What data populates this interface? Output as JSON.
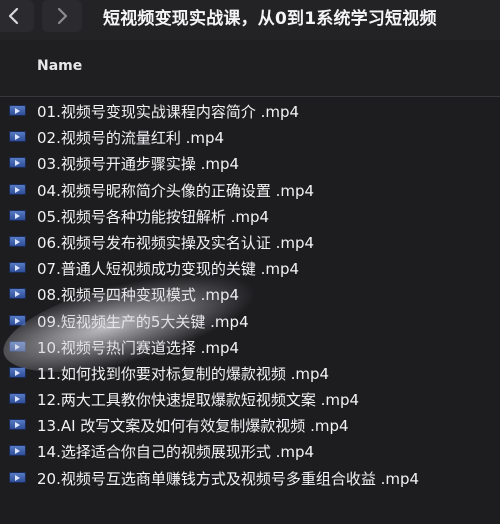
{
  "window": {
    "title": "短视频变现实战课，从0到1系统学习短视频"
  },
  "toolbar": {
    "back_icon": "chevron-left-icon",
    "forward_icon": "chevron-right-icon"
  },
  "columns": {
    "name": "Name"
  },
  "files": [
    {
      "name": "01.视频号变现实战课程内容简介 .mp4"
    },
    {
      "name": "02.视频号的流量红利 .mp4"
    },
    {
      "name": "03.视频号开通步骤实操 .mp4"
    },
    {
      "name": "04.视频号昵称简介头像的正确设置 .mp4"
    },
    {
      "name": "05.视频号各种功能按钮解析 .mp4"
    },
    {
      "name": "06.视频号发布视频实操及实名认证 .mp4"
    },
    {
      "name": "07.普通人短视频成功变现的关键 .mp4"
    },
    {
      "name": "08.视频号四种变现模式 .mp4"
    },
    {
      "name": "09.短视频生产的5大关键 .mp4"
    },
    {
      "name": "10.视频号热门赛道选择 .mp4"
    },
    {
      "name": "11.如何找到你要对标复制的爆款视频 .mp4"
    },
    {
      "name": "12.两大工具教你快速提取爆款短视频文案 .mp4"
    },
    {
      "name": "13.AI 改写文案及如何有效复制爆款视频 .mp4"
    },
    {
      "name": "14.选择适合你自己的视频展现形式 .mp4"
    },
    {
      "name": "20.视频号互选商单赚钱方式及视频号多重组合收益 .mp4"
    }
  ],
  "colors": {
    "background": "#1d1d20",
    "text": "#f2f2f4",
    "file_icon": "#3b5fae"
  }
}
